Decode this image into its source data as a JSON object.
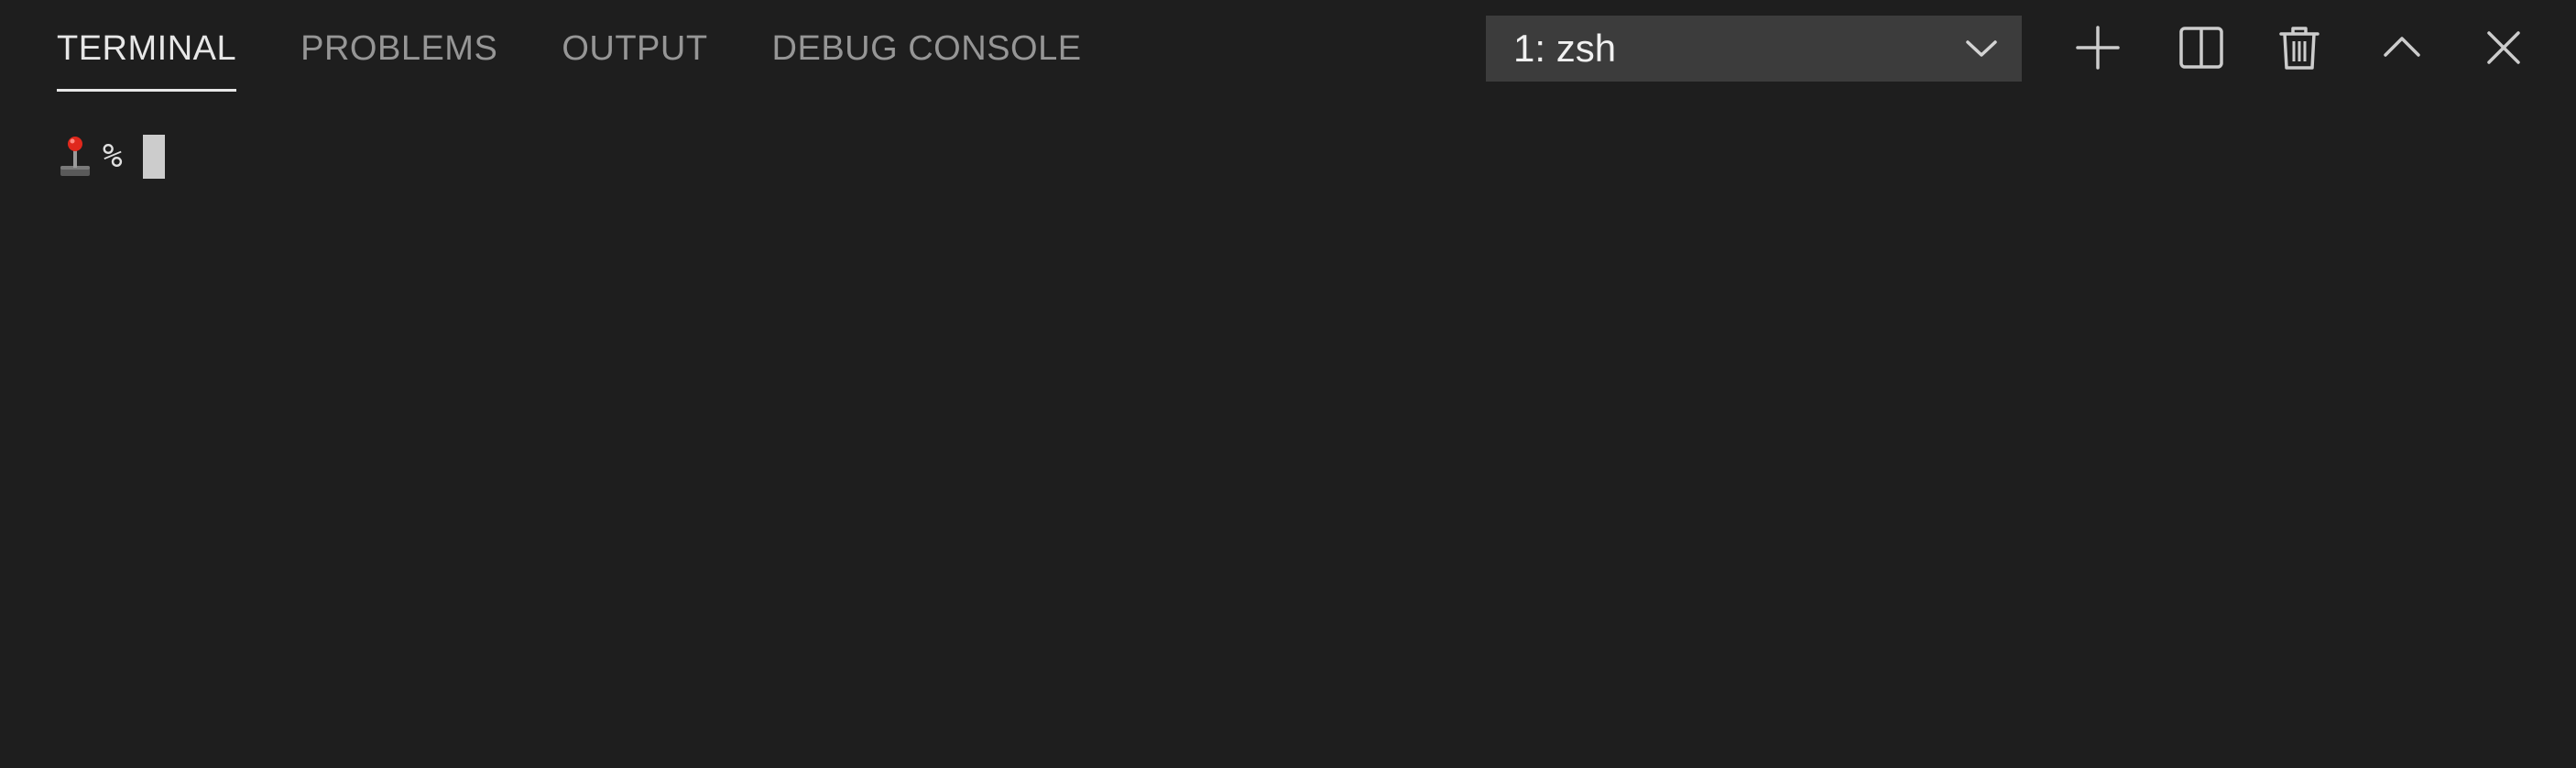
{
  "tabs": [
    {
      "label": "TERMINAL",
      "active": true
    },
    {
      "label": "PROBLEMS",
      "active": false
    },
    {
      "label": "OUTPUT",
      "active": false
    },
    {
      "label": "DEBUG CONSOLE",
      "active": false
    }
  ],
  "terminal_select": {
    "value": "1: zsh"
  },
  "actions": {
    "new": "plus-icon",
    "split": "split-icon",
    "kill": "trash-icon",
    "maximize": "chevron-up-icon",
    "close": "close-icon"
  },
  "prompt": {
    "glyph": "joystick-icon",
    "symbol": "%"
  },
  "colors": {
    "background": "#1e1e1e",
    "select_background": "#3c3c3c",
    "active_tab": "#e7e7e7",
    "inactive_tab": "#969696",
    "cursor": "#cccccc",
    "joystick_knob": "#e0281c"
  }
}
